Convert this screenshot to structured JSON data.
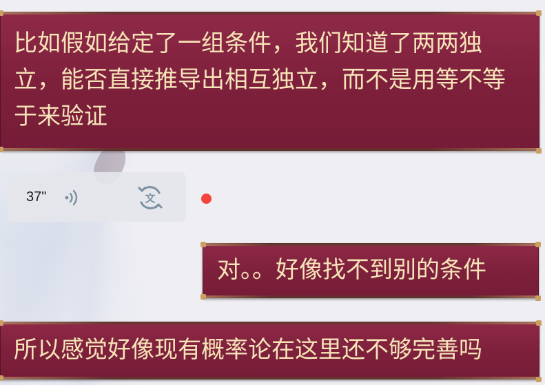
{
  "messages": [
    {
      "id": "msg-1",
      "text": "比如假如给定了一组条件，我们知道了两两独立，能否直接推导出相互独立，而不是用等不等于来验证"
    },
    {
      "id": "msg-voice",
      "duration": "37\"",
      "icons": [
        "voice-wave-icon",
        "speech-to-text-icon"
      ],
      "unread": true
    },
    {
      "id": "msg-2",
      "text": "对。。好像找不到别的条件"
    },
    {
      "id": "msg-3",
      "text": "所以感觉好像现有概率论在这里还不够完善吗"
    }
  ],
  "colors": {
    "bubble_bg": "#7e203c",
    "bubble_text": "#f6e4b8",
    "voice_bubble_bg": "#e4e6ec",
    "unread_dot": "#f5443b",
    "icon_gray": "#7a8fa0"
  }
}
